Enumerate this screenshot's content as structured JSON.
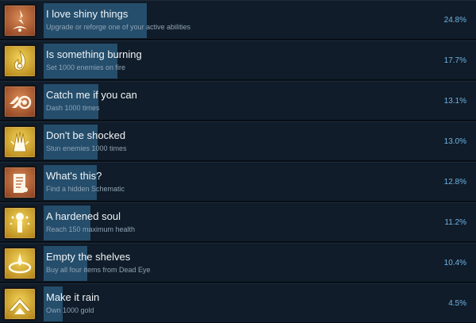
{
  "achievements": [
    {
      "title": "I love shiny things",
      "description": "Upgrade or reforge one of your active abilities",
      "percent_label": "24.8%",
      "percent": 24.8,
      "icon": "lightning-rune-icon",
      "icon_color": "#b0643a"
    },
    {
      "title": "Is something burning",
      "description": "Set 1000 enemies on fire",
      "percent_label": "17.7%",
      "percent": 17.7,
      "icon": "flame-icon",
      "icon_color": "#e0b93a"
    },
    {
      "title": "Catch me if you can",
      "description": "Dash 1000 times",
      "percent_label": "13.1%",
      "percent": 13.1,
      "icon": "dash-icon",
      "icon_color": "#b0643a"
    },
    {
      "title": "Don't be shocked",
      "description": "Stun enemies 1000 times",
      "percent_label": "13.0%",
      "percent": 13.0,
      "icon": "shock-claw-icon",
      "icon_color": "#e0b93a"
    },
    {
      "title": "What's this?",
      "description": "Find a hidden Schematic",
      "percent_label": "12.8%",
      "percent": 12.8,
      "icon": "scroll-icon",
      "icon_color": "#b0643a"
    },
    {
      "title": "A hardened soul",
      "description": "Reach 150 maximum health",
      "percent_label": "11.2%",
      "percent": 11.2,
      "icon": "soul-totem-icon",
      "icon_color": "#e0b93a"
    },
    {
      "title": "Empty the shelves",
      "description": "Buy all four items from Dead Eye",
      "percent_label": "10.4%",
      "percent": 10.4,
      "icon": "shop-ring-icon",
      "icon_color": "#e0b93a"
    },
    {
      "title": "Make it rain",
      "description": "Own 1000 gold",
      "percent_label": "4.5%",
      "percent": 4.5,
      "icon": "gold-chevron-icon",
      "icon_color": "#e0b93a"
    }
  ]
}
